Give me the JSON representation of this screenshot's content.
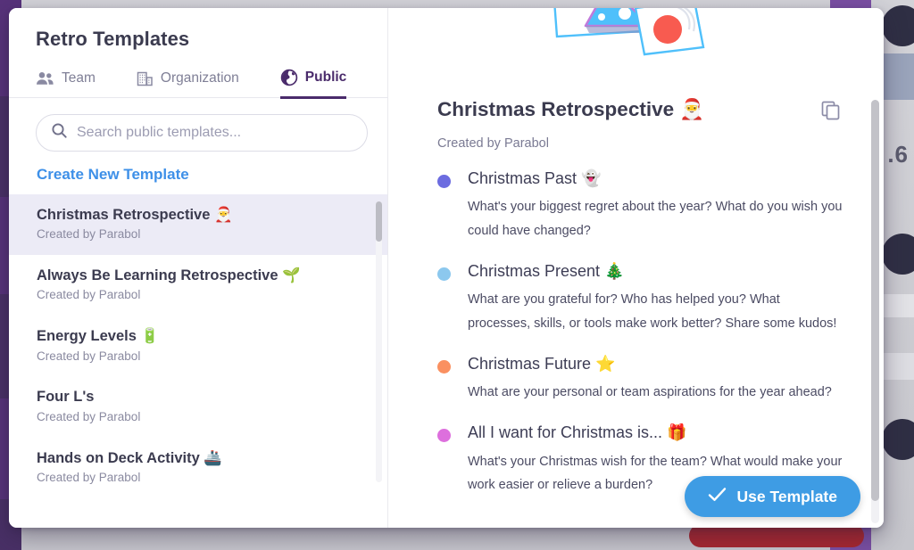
{
  "modal": {
    "left_pane": {
      "title": "Retro Templates",
      "tabs": [
        {
          "label": "Team",
          "icon": "people-icon",
          "active": false
        },
        {
          "label": "Organization",
          "icon": "building-icon",
          "active": false
        },
        {
          "label": "Public",
          "icon": "globe-icon",
          "active": true
        }
      ],
      "search": {
        "value": "",
        "placeholder": "Search public templates...",
        "icon": "search-icon"
      },
      "create_new_label": "Create New Template",
      "templates": [
        {
          "name": "Christmas Retrospective 🎅",
          "author": "Created by Parabol",
          "selected": true
        },
        {
          "name": "Always Be Learning Retrospective 🌱",
          "author": "Created by Parabol",
          "selected": false
        },
        {
          "name": "Energy Levels 🔋",
          "author": "Created by Parabol",
          "selected": false
        },
        {
          "name": "Four L's",
          "author": "Created by Parabol",
          "selected": false
        },
        {
          "name": "Hands on Deck Activity 🚢",
          "author": "Created by Parabol",
          "selected": false
        }
      ]
    },
    "detail": {
      "title": "Christmas Retrospective 🎅",
      "author": "Created by Parabol",
      "copy_icon": "copy-icon",
      "prompts": [
        {
          "color": "#6c6ce0",
          "question": "Christmas Past 👻",
          "description": "What's your biggest regret about the year? What do you wish you could have changed?"
        },
        {
          "color": "#8cc8ee",
          "question": "Christmas Present 🎄",
          "description": "What are you grateful for? Who has helped you? What processes, skills, or tools make work better? Share some kudos!"
        },
        {
          "color": "#fa9060",
          "question": "Christmas Future ⭐",
          "description": "What are your personal or team aspirations for the year ahead?"
        },
        {
          "color": "#dd6fdd",
          "question": "All I want for Christmas is... 🎁",
          "description": "What's your Christmas wish for the team? What would make your work easier or relieve a burden?"
        }
      ],
      "use_template_label": "Use Template",
      "use_template_icon": "check-icon"
    }
  },
  "background": {
    "partial_number": ".6"
  },
  "colors": {
    "accent_blue": "#3e9ce4",
    "link_blue": "#3e90e8",
    "active_tab_purple": "#4a2b6b",
    "selected_row": "#ecebf6",
    "sidebar_purple": "#57327a"
  }
}
